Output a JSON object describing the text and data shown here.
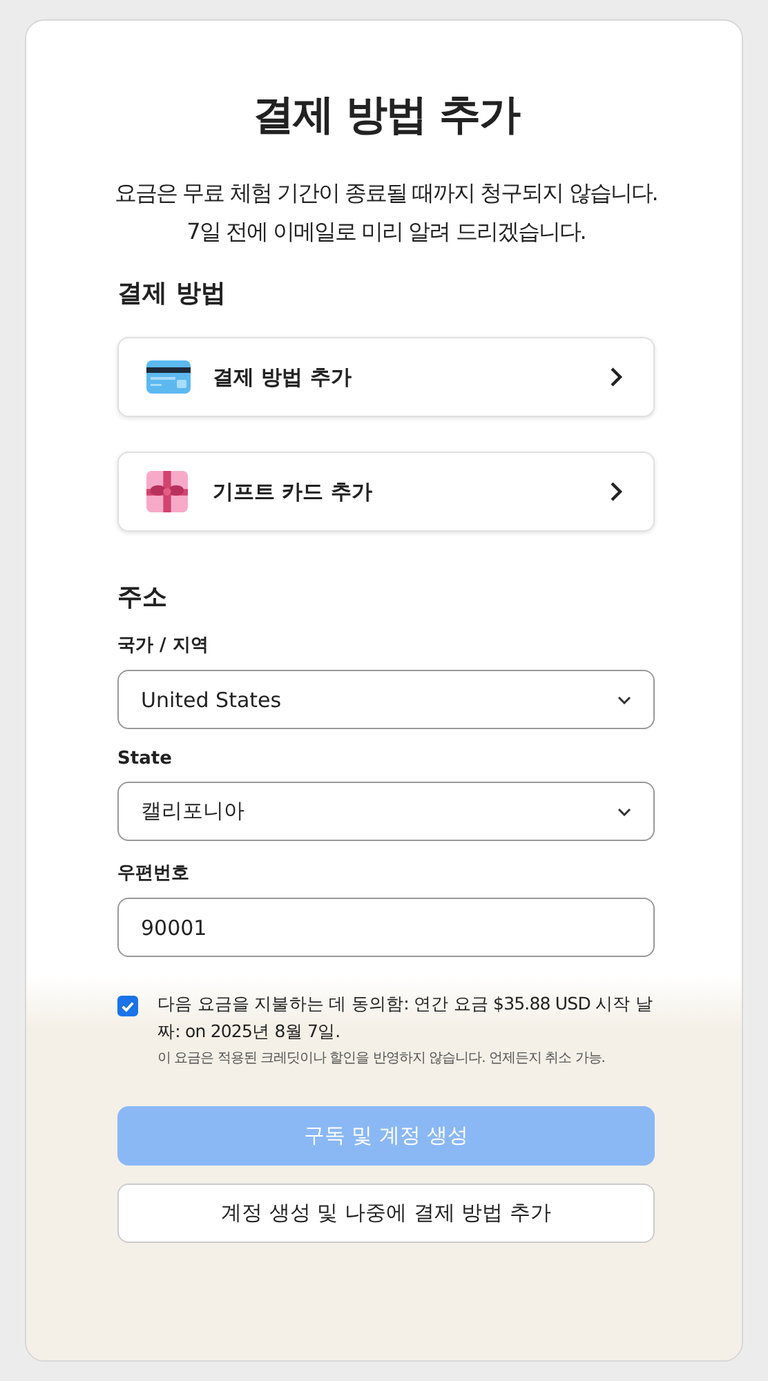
{
  "title": "결제 방법 추가",
  "description": "요금은 무료 체험 기간이 종료될 때까지 청구되지 않습니다. 7일 전에 이메일로 미리 알려 드리겠습니다.",
  "payment_section": {
    "heading": "결제 방법",
    "options": [
      {
        "kind": "card",
        "label": "결제 방법 추가"
      },
      {
        "kind": "gift",
        "label": "기프트 카드 추가"
      }
    ]
  },
  "address_section": {
    "heading": "주소",
    "fields": [
      {
        "kind": "select",
        "label": "국가 / 지역",
        "value": "United States"
      },
      {
        "kind": "select",
        "label": "State",
        "value": "캘리포니아"
      },
      {
        "kind": "text",
        "label": "우편번호",
        "value": "90001"
      }
    ]
  },
  "consent": {
    "checked": true,
    "text": "다음 요금을 지불하는 데 동의함: 연간 요금 $35.88 USD 시작 날짜: on 2025년 8월 7일.",
    "note": "이 요금은 적용된 크레딧이나 할인을 반영하지 않습니다. 언제든지 취소 가능."
  },
  "buttons": [
    {
      "kind": "primary",
      "label": "구독 및 계정 생성",
      "disabled": true
    },
    {
      "kind": "secondary",
      "label": "계정 생성 및 나중에 결제 방법 추가",
      "disabled": false
    }
  ]
}
